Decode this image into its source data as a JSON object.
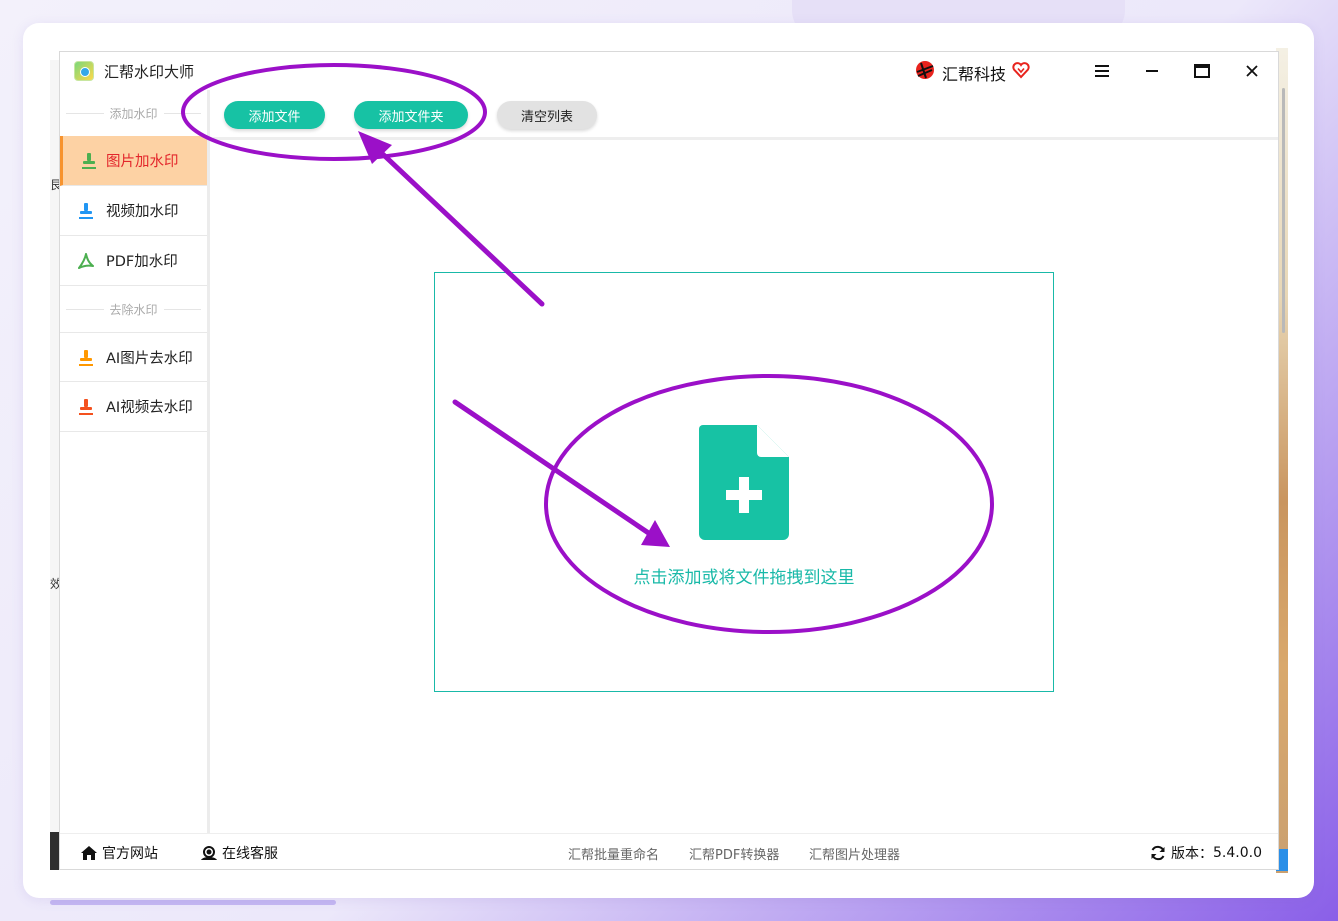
{
  "window": {
    "app_title": "汇帮水印大师",
    "brand_name": "汇帮科技"
  },
  "sidebar": {
    "section_add": "添加水印",
    "section_remove": "去除水印",
    "items": [
      {
        "label": "图片加水印",
        "active": true,
        "icon": "stamp-icon",
        "color": "#4caf50"
      },
      {
        "label": "视频加水印",
        "active": false,
        "icon": "stamp-icon",
        "color": "#2196f3"
      },
      {
        "label": "PDF加水印",
        "active": false,
        "icon": "pdf-icon",
        "color": "#4caf50"
      },
      {
        "label": "AI图片去水印",
        "active": false,
        "icon": "stamp-icon",
        "color": "#ff9800"
      },
      {
        "label": "AI视频去水印",
        "active": false,
        "icon": "stamp-icon",
        "color": "#f4511e"
      }
    ]
  },
  "toolbar": {
    "add_file": "添加文件",
    "add_folder": "添加文件夹",
    "clear_list": "清空列表"
  },
  "dropzone": {
    "text": "点击添加或将文件拖拽到这里",
    "icon": "file-add-icon"
  },
  "footer": {
    "official_site": "官方网站",
    "online_service": "在线客服",
    "links": [
      "汇帮批量重命名",
      "汇帮PDF转换器",
      "汇帮图片处理器"
    ],
    "version_label": "版本：",
    "version_value": "5.4.0.0"
  },
  "colors": {
    "accent": "#17c2a4",
    "active_bg": "#fdd2a4",
    "active_text": "#e3262b",
    "annotation": "#9b10c8"
  }
}
